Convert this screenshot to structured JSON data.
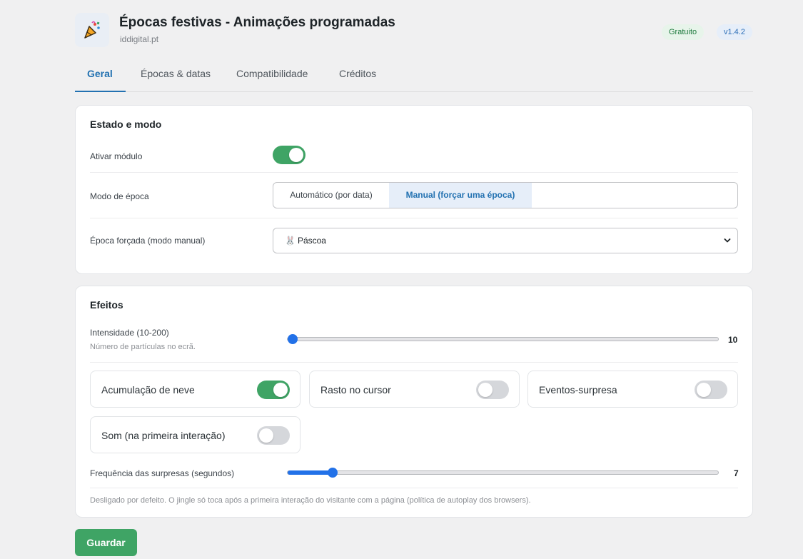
{
  "header": {
    "title": "Épocas festivas - Animações programadas",
    "subtitle": "iddigital.pt",
    "badge_plan": "Gratuito",
    "badge_version": "v1.4.2"
  },
  "tabs": [
    {
      "label": "Geral",
      "active": true
    },
    {
      "label": "Épocas & datas",
      "active": false
    },
    {
      "label": "Compatibilidade",
      "active": false
    },
    {
      "label": "Créditos",
      "active": false
    }
  ],
  "estado": {
    "title": "Estado e modo",
    "ativar_label": "Ativar módulo",
    "ativar_on": true,
    "modo_label": "Modo de época",
    "modo_options": [
      "Automático (por data)",
      "Manual (forçar uma época)"
    ],
    "modo_selected": "Manual (forçar uma época)",
    "forcada_label": "Época forçada (modo manual)",
    "forcada_emoji": "🐰",
    "forcada_value": "Páscoa"
  },
  "efeitos": {
    "title": "Efeitos",
    "intensidade_label": "Intensidade (10-200)",
    "intensidade_hint": "Número de partículas no ecrã.",
    "intensidade_min": 10,
    "intensidade_max": 200,
    "intensidade_value": "10",
    "features": [
      {
        "label": "Acumulação de neve",
        "on": true
      },
      {
        "label": "Rasto no cursor",
        "on": false
      },
      {
        "label": "Eventos-surpresa",
        "on": false
      },
      {
        "label": "Som (na primeira interação)",
        "on": false
      }
    ],
    "frequencia_label": "Frequência das surpresas (segundos)",
    "frequencia_value": "7",
    "frequencia_fraction": 0.105,
    "nota": "Desligado por defeito. O jingle só toca após a primeira interação do visitante com a página (política de autoplay dos browsers)."
  },
  "actions": {
    "save_label": "Guardar"
  },
  "colors": {
    "accent": "#2271b1",
    "toggle_on": "#3fa465",
    "slider": "#2271e8"
  }
}
